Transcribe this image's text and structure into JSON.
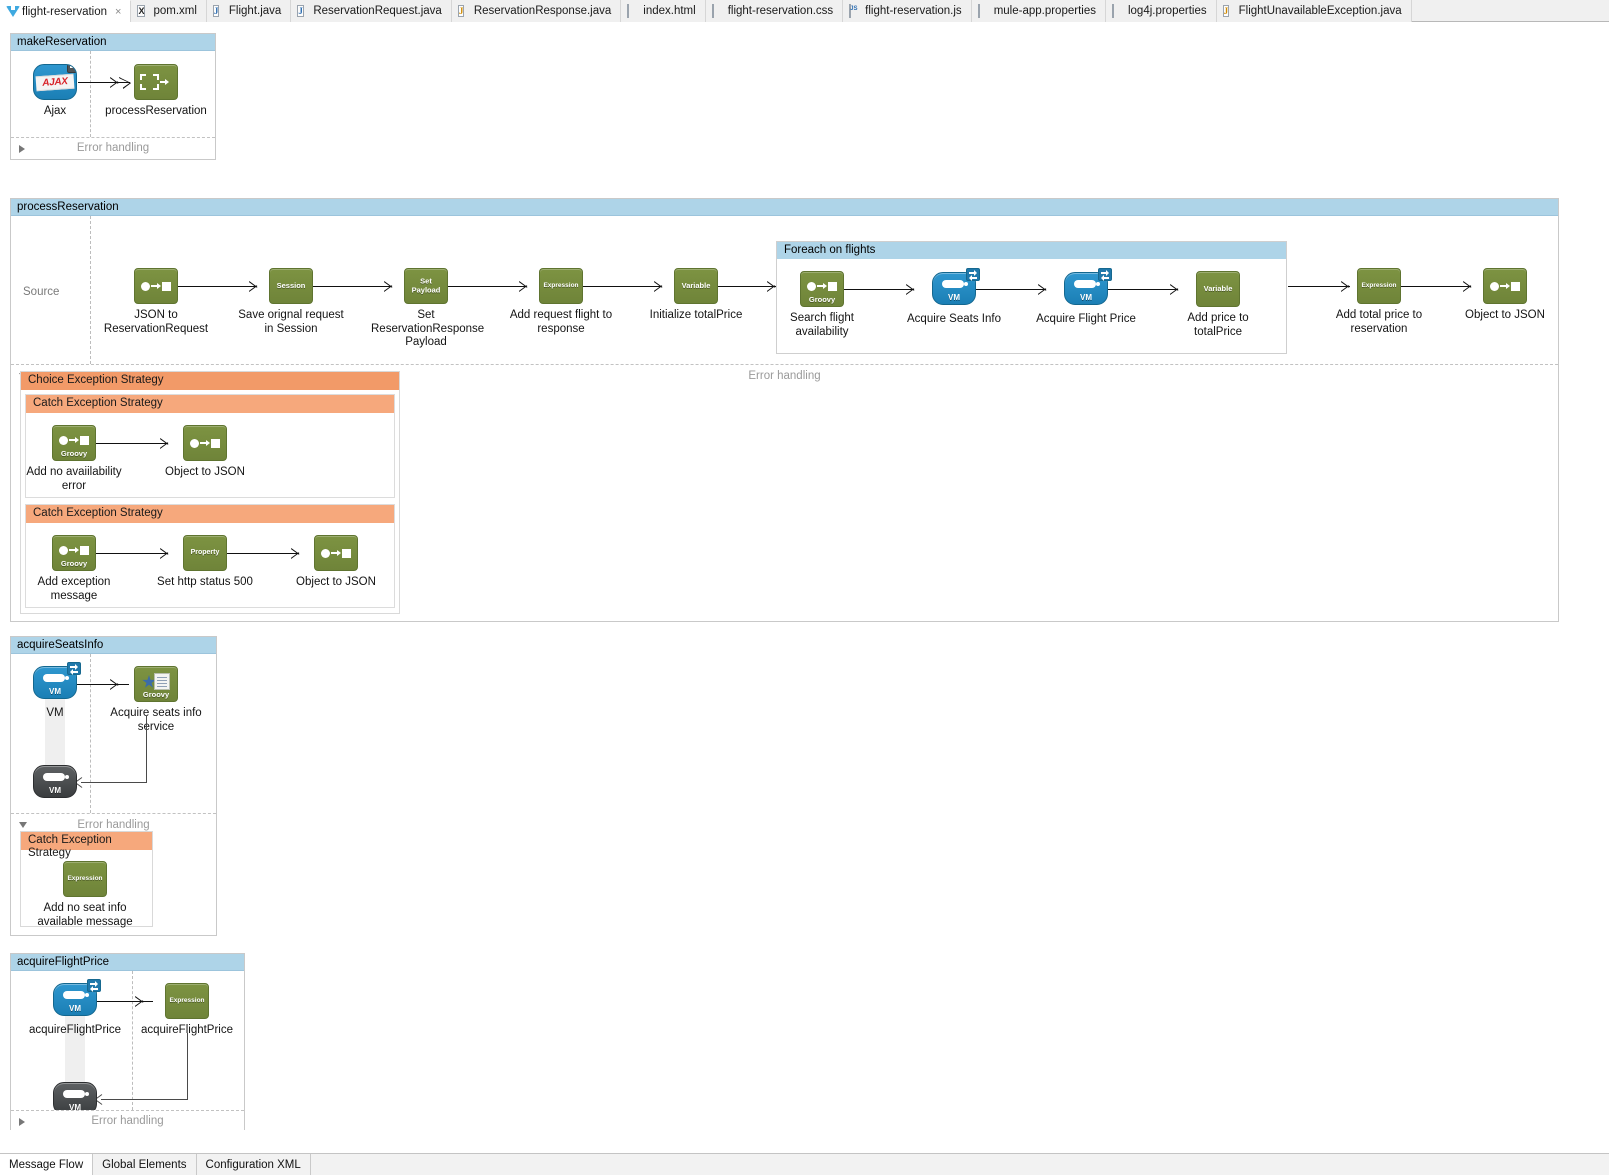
{
  "editor_tabs": [
    {
      "label": "flight-reservation",
      "icon": "mule-icon",
      "active": true,
      "closable": true
    },
    {
      "label": "pom.xml",
      "icon": "xml-icon",
      "active": false,
      "closable": false
    },
    {
      "label": "Flight.java",
      "icon": "java-icon",
      "active": false,
      "closable": false
    },
    {
      "label": "ReservationRequest.java",
      "icon": "java-icon",
      "active": false,
      "closable": false
    },
    {
      "label": "ReservationResponse.java",
      "icon": "java-warning-icon",
      "active": false,
      "closable": false
    },
    {
      "label": "index.html",
      "icon": "doc-icon",
      "active": false,
      "closable": false
    },
    {
      "label": "flight-reservation.css",
      "icon": "doc-icon",
      "active": false,
      "closable": false
    },
    {
      "label": "flight-reservation.js",
      "icon": "js-icon",
      "active": false,
      "closable": false
    },
    {
      "label": "mule-app.properties",
      "icon": "doc-icon",
      "active": false,
      "closable": false
    },
    {
      "label": "log4j.properties",
      "icon": "doc-icon",
      "active": false,
      "closable": false
    },
    {
      "label": "FlightUnavailableException.java",
      "icon": "java-icon",
      "active": false,
      "closable": false
    }
  ],
  "close_glyph": "×",
  "flows": {
    "make_reservation": {
      "title": "makeReservation",
      "error_handling_label": "Error handling",
      "error_handling_expanded": false,
      "nodes": [
        {
          "name": "Ajax",
          "icon": "ajax-icon"
        },
        {
          "name": "processReservation",
          "icon": "flow-ref-icon"
        }
      ]
    },
    "process_reservation": {
      "title": "processReservation",
      "source_label": "Source",
      "error_handling_label": "Error handling",
      "error_handling_expanded": true,
      "nodes": [
        {
          "name": "JSON to ReservationRequest",
          "icon": "transformer-icon",
          "badge": ""
        },
        {
          "name": "Save orignal request in Session",
          "icon": "session-variable-icon",
          "badge": "Session"
        },
        {
          "name": "Set ReservationResponse Payload",
          "icon": "set-payload-icon",
          "badge": "Set Payload"
        },
        {
          "name": "Add request flight to response",
          "icon": "expression-icon",
          "badge": "Expression"
        },
        {
          "name": "Initialize totalPrice",
          "icon": "variable-icon",
          "badge": "Variable"
        }
      ],
      "scope": {
        "title": "Foreach on flights",
        "nodes": [
          {
            "name": "Search flight availability",
            "icon": "groovy-icon",
            "badge": "Groovy"
          },
          {
            "name": "Acquire Seats Info",
            "icon": "vm-icon",
            "badge": "VM"
          },
          {
            "name": "Acquire Flight Price",
            "icon": "vm-icon",
            "badge": "VM"
          },
          {
            "name": "Add price to totalPrice",
            "icon": "variable-icon",
            "badge": "Variable"
          }
        ]
      },
      "tail_nodes": [
        {
          "name": "Add total price to reservation",
          "icon": "expression-icon",
          "badge": "Expression"
        },
        {
          "name": "Object to JSON",
          "icon": "transformer-icon",
          "badge": ""
        }
      ],
      "exception_strategy": {
        "title": "Choice Exception Strategy",
        "catches": [
          {
            "title": "Catch Exception Strategy",
            "nodes": [
              {
                "name": "Add no avaiilability error",
                "icon": "groovy-icon",
                "badge": "Groovy"
              },
              {
                "name": "Object to JSON",
                "icon": "transformer-icon",
                "badge": ""
              }
            ]
          },
          {
            "title": "Catch Exception Strategy",
            "nodes": [
              {
                "name": "Add exception message",
                "icon": "groovy-icon",
                "badge": "Groovy"
              },
              {
                "name": "Set http status 500",
                "icon": "property-icon",
                "badge": "Property"
              },
              {
                "name": "Object to JSON",
                "icon": "transformer-icon",
                "badge": ""
              }
            ]
          }
        ]
      }
    },
    "acquire_seats_info": {
      "title": "acquireSeatsInfo",
      "error_handling_label": "Error handling",
      "error_handling_expanded": true,
      "nodes": [
        {
          "name": "VM",
          "icon": "vm-icon",
          "badge": "VM"
        },
        {
          "name": "Acquire seats info service",
          "icon": "groovy-script-icon",
          "badge": "Groovy"
        },
        {
          "name": "",
          "icon": "vm-response-icon",
          "badge": "VM"
        }
      ],
      "exception_strategy": {
        "title": "Catch Exception Strategy",
        "nodes": [
          {
            "name": "Add no seat info available message",
            "icon": "expression-icon",
            "badge": "Expression"
          }
        ]
      }
    },
    "acquire_flight_price": {
      "title": "acquireFlightPrice",
      "error_handling_label": "Error handling",
      "error_handling_expanded": false,
      "nodes": [
        {
          "name": "acquireFlightPrice",
          "icon": "vm-icon",
          "badge": "VM"
        },
        {
          "name": "acquireFlightPrice",
          "icon": "expression-icon",
          "badge": "Expression"
        },
        {
          "name": "",
          "icon": "vm-response-icon",
          "badge": "VM"
        }
      ]
    }
  },
  "bottom_tabs": [
    {
      "label": "Message Flow",
      "active": true
    },
    {
      "label": "Global Elements",
      "active": false
    },
    {
      "label": "Configuration XML",
      "active": false
    }
  ],
  "colors": {
    "flow_header": "#aed4e8",
    "exception_header": "#f29a68",
    "catch_header": "#f6a87c",
    "processor_green": "#7d9342",
    "vm_blue": "#2f97cf",
    "vm_dark": "#4f5356"
  }
}
